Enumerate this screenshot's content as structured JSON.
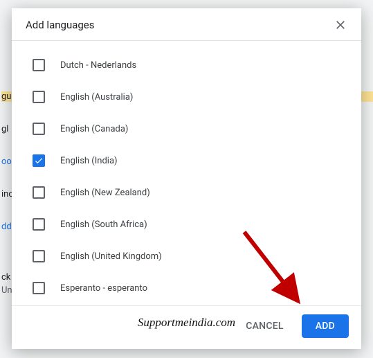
{
  "dialog": {
    "title": "Add languages",
    "cancel_label": "CANCEL",
    "add_label": "ADD"
  },
  "languages": [
    {
      "label": "Dutch - Nederlands",
      "checked": false
    },
    {
      "label": "English (Australia)",
      "checked": false
    },
    {
      "label": "English (Canada)",
      "checked": false
    },
    {
      "label": "English (India)",
      "checked": true
    },
    {
      "label": "English (New Zealand)",
      "checked": false
    },
    {
      "label": "English (South Africa)",
      "checked": false
    },
    {
      "label": "English (United Kingdom)",
      "checked": false
    },
    {
      "label": "Esperanto - esperanto",
      "checked": false
    }
  ],
  "watermark": "Supportmeindia.com",
  "colors": {
    "accent": "#1a73e8",
    "arrow": "#c00000"
  }
}
